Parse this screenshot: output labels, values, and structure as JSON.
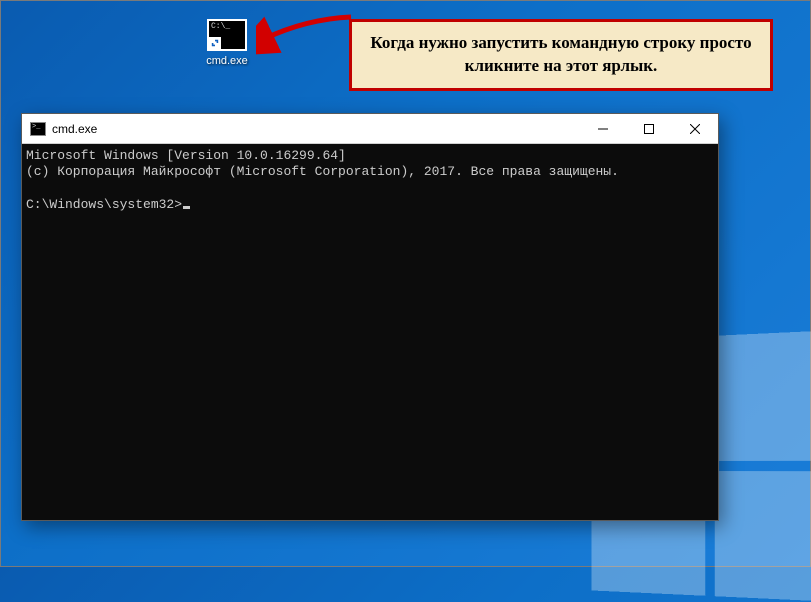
{
  "desktop": {
    "icon_label": "cmd.exe"
  },
  "callout": {
    "text": "Когда нужно запустить командную строку просто кликните на этот ярлык."
  },
  "window": {
    "title": "cmd.exe",
    "terminal": {
      "line1": "Microsoft Windows [Version 10.0.16299.64]",
      "line2": "(с) Корпорация Майкрософт (Microsoft Corporation), 2017. Все права защищены.",
      "blank": "",
      "prompt": "C:\\Windows\\system32>"
    }
  }
}
